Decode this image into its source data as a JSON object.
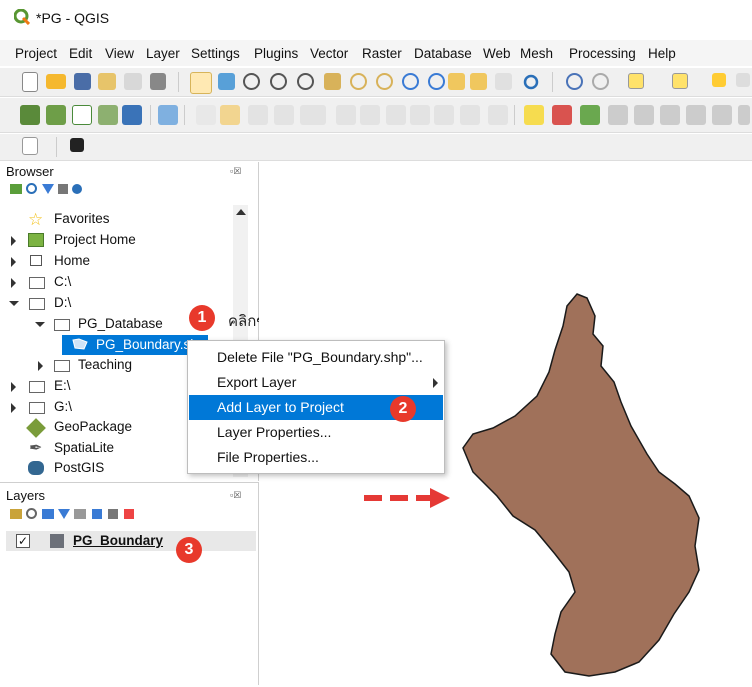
{
  "window": {
    "title": "*PG - QGIS"
  },
  "menubar": {
    "items": [
      "Project",
      "Edit",
      "View",
      "Layer",
      "Settings",
      "Plugins",
      "Vector",
      "Raster",
      "Database",
      "Web",
      "Mesh",
      "Processing",
      "Help"
    ]
  },
  "browser": {
    "title": "Browser",
    "items": {
      "favorites": "Favorites",
      "project_home": "Project Home",
      "home": "Home",
      "c": "C:\\",
      "d": "D:\\",
      "pg_database": "PG_Database",
      "pg_boundary": "PG_Boundary.shp",
      "teaching": "Teaching",
      "e": "E:\\",
      "g": "G:\\",
      "geopackage": "GeoPackage",
      "spatialite": "SpatiaLite",
      "postgis": "PostGIS"
    }
  },
  "annotation": {
    "step1_text": "คลิกขวาที่ PG_Boundary.shp",
    "step1": "1",
    "step2": "2",
    "step3": "3"
  },
  "context_menu": {
    "delete_file": "Delete File \"PG_Boundary.shp\"...",
    "export_layer": "Export Layer",
    "add_layer": "Add Layer to Project",
    "layer_properties": "Layer Properties...",
    "file_properties": "File Properties..."
  },
  "layers": {
    "title": "Layers",
    "layer_name": "PG_Boundary"
  },
  "colors": {
    "polygon_fill": "#a0715a",
    "selection": "#0078d7",
    "badge": "#e8392b",
    "arrow": "#e53935"
  },
  "icons": [
    "qgis-logo-icon",
    "star-icon",
    "project-home-icon",
    "home-icon",
    "folder-icon",
    "polygon-layer-icon",
    "geopackage-icon",
    "spatialite-icon",
    "postgis-icon",
    "refresh-icon",
    "filter-icon"
  ]
}
